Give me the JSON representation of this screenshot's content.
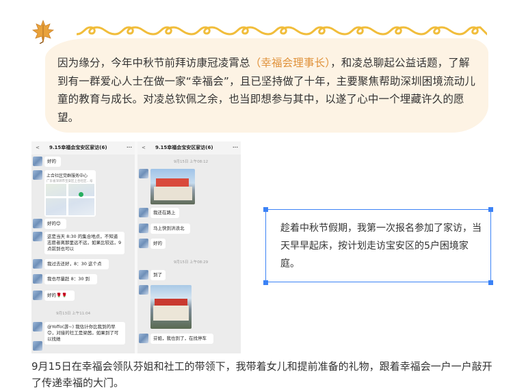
{
  "intro": {
    "part1": "因为缘分，今年中秋节前拜访康冠凌霄总",
    "highlight": "（幸福会理事长）",
    "part2": "，和凌总聊起公益话题，了解到有一群爱心人士在做一家“幸福会”，且已坚持做了十年，主要聚焦帮助深圳困境流动儿童的教育与成长。对凌总钦佩之余，也当即想参与其中，以遂了心中一个埋藏许久的愿望。"
  },
  "colors": {
    "accent": "#e0923b",
    "card_bg": "#fdf3e4",
    "selection": "#3b82f6",
    "squiggle": "#f1bd3b"
  },
  "chat_left": {
    "title": "9.15幸福会宝安区家访(6)",
    "back": "<",
    "more": "···",
    "msg1": "好的",
    "map_title": "上合社区党群服务中心",
    "map_addr": "广东省深圳市宝安区上合社区…号",
    "msg2": "好的😊",
    "msg3": "这是当天 8:30 的集合地点，不知道志愿者离那里远不远，如果比较远，9点前到也可以",
    "msg4": "我过去还好，8：30 这个点",
    "msg5": "我也尽量赶 8：30 到",
    "msg6": "好的🌹🌹",
    "time1": "9月13日 上午11:04",
    "msg7": "@Yoffo(游~) 我估计你比我到的早😊，对接的社工是梁茜，如果到了可以找她"
  },
  "chat_right": {
    "title": "9.15幸福会宝安区家访(6)",
    "back": "<",
    "more": "···",
    "time1": "9月15日 上午08:12",
    "msg1": "我还在路上",
    "msg2": "马上快到洪浪北",
    "msg3": "好的",
    "time2": "9月15日 上午08:29",
    "msg4": "到了",
    "msg5": "芬姐，我也到了，在找停车"
  },
  "callout": {
    "text": "趁着中秋节假期，我第一次报名参加了家访，当天早早起床，按计划走访宝安区的5户困境家庭。"
  },
  "caption": {
    "text": "9月15日在幸福会领队芬姐和社工的带领下，我带着女儿和提前准备的礼物，跟着幸福会一户一户敲开了传递幸福的大门。"
  }
}
